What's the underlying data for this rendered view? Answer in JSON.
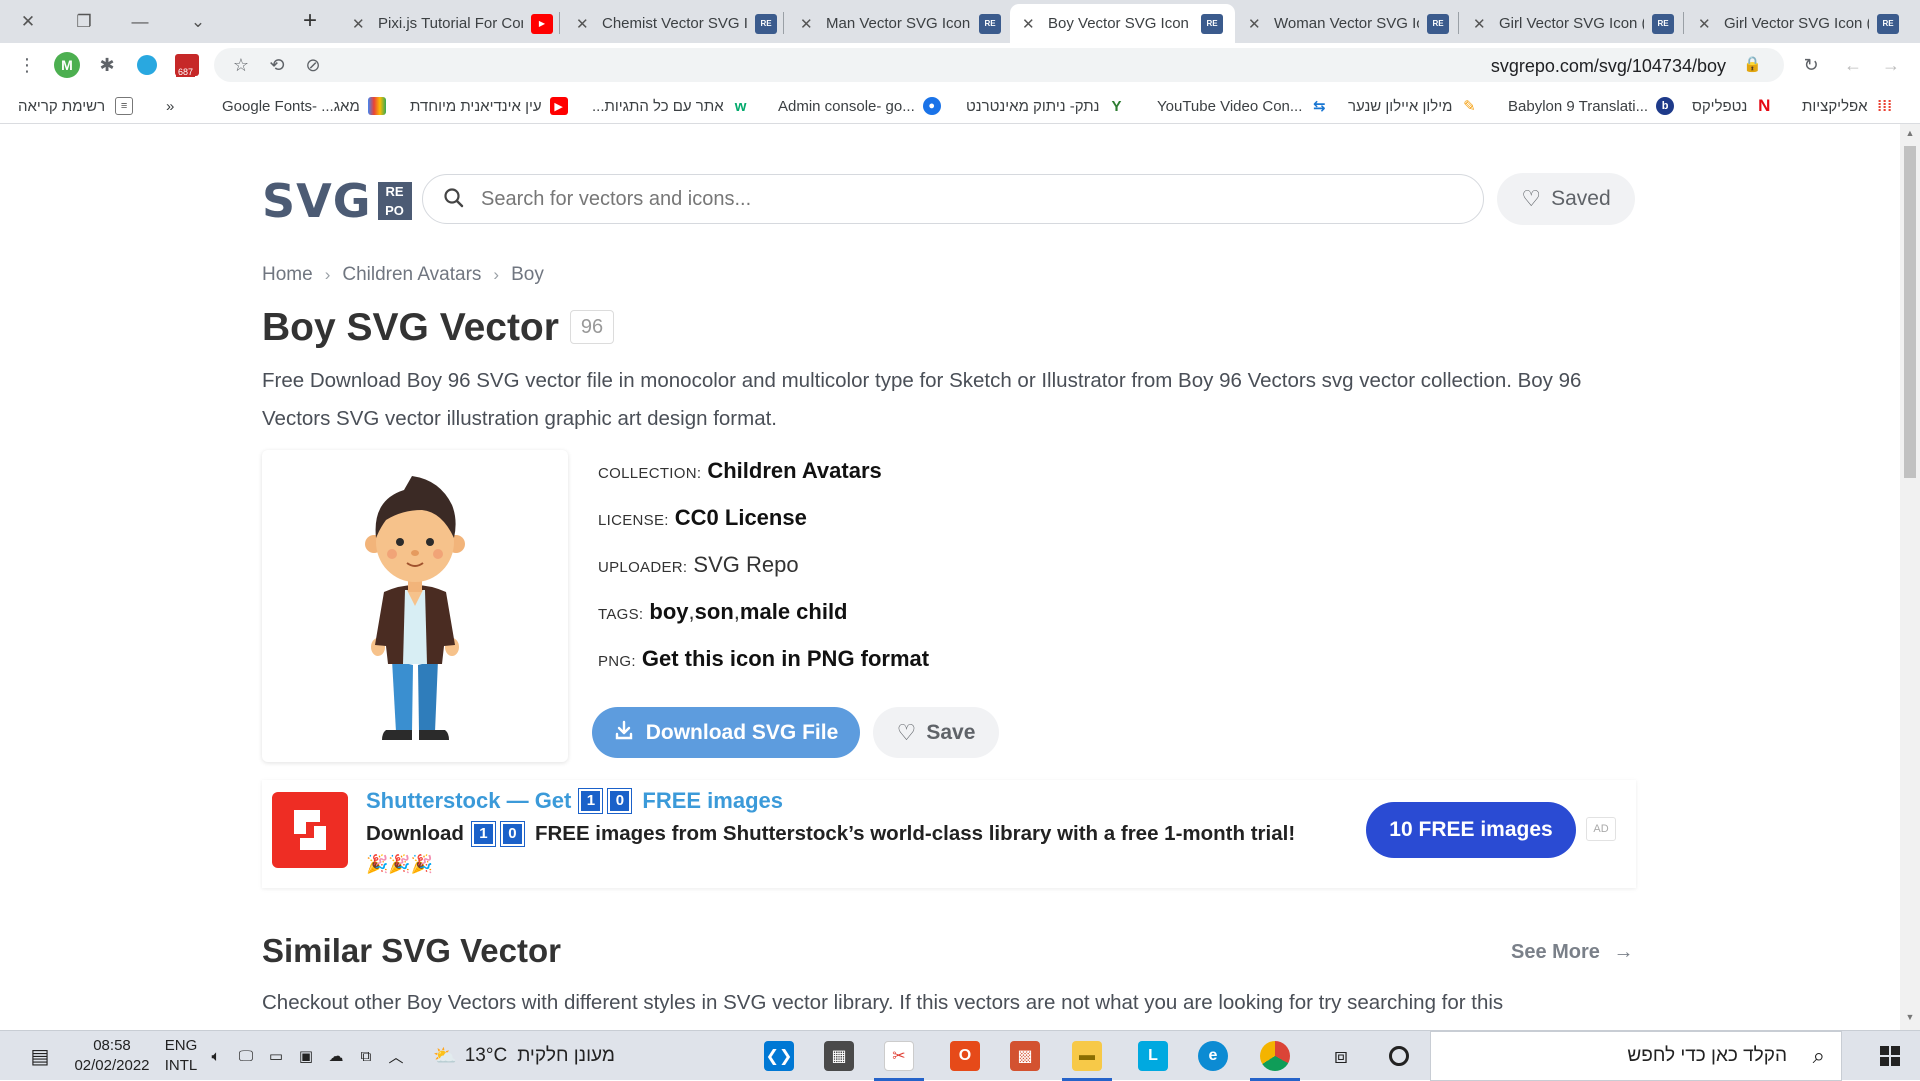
{
  "browser": {
    "window_controls": {
      "close": "✕",
      "restore": "❐",
      "minimize": "—",
      "tab_search": "⌄"
    },
    "new_tab": "+",
    "tabs": [
      {
        "title": "Pixi.js Tutorial For Con",
        "favicon": "youtube-icon",
        "active": false
      },
      {
        "title": "Chemist Vector SVG I",
        "favicon": "svgrepo-icon",
        "active": false
      },
      {
        "title": "Man Vector SVG Icon",
        "favicon": "svgrepo-icon",
        "active": false
      },
      {
        "title": "Boy Vector SVG Icon (",
        "favicon": "svgrepo-icon",
        "active": true
      },
      {
        "title": "Woman Vector SVG Ic",
        "favicon": "svgrepo-icon",
        "active": false
      },
      {
        "title": "Girl Vector SVG Icon (",
        "favicon": "svgrepo-icon",
        "active": false
      },
      {
        "title": "Girl Vector SVG Icon (",
        "favicon": "svgrepo-icon",
        "active": false
      }
    ],
    "address": {
      "url": "svgrepo.com/svg/104734/boy"
    },
    "extension_badge": "687",
    "profile_initial": "M",
    "bookmarks": [
      {
        "label": "רשימת קריאה",
        "icon": "reading-list-icon"
      },
      {
        "label": "»",
        "icon": ""
      },
      {
        "label": "Google Fonts- ...מאג",
        "icon": "google-fonts-icon"
      },
      {
        "label": "עין אינדיאנית מיוחדת",
        "icon": "youtube-icon"
      },
      {
        "label": "...אתר עם כל התגיות",
        "icon": "w3schools-icon"
      },
      {
        "label": "Admin console- go...",
        "icon": "admin-console-icon"
      },
      {
        "label": "נתק- ניתוק מאינטרנט",
        "icon": "disconnect-icon"
      },
      {
        "label": "YouTube Video Con...",
        "icon": "converter-icon"
      },
      {
        "label": "מילון איילון שנער",
        "icon": "dictionary-icon"
      },
      {
        "label": "Babylon 9 Translati...",
        "icon": "babylon-icon"
      },
      {
        "label": "נטפליקס",
        "icon": "netflix-icon"
      },
      {
        "label": "אפליקציות",
        "icon": "apps-icon"
      }
    ]
  },
  "site": {
    "logo_main": "SVG",
    "logo_sub_1": "RE",
    "logo_sub_2": "PO",
    "search_placeholder": "Search for vectors and icons...",
    "saved_label": "Saved",
    "breadcrumb": [
      "Home",
      "Children Avatars",
      "Boy"
    ],
    "title": "Boy SVG Vector",
    "title_badge": "96",
    "description": "Free Download Boy 96 SVG vector file in monocolor and multicolor type for Sketch or Illustrator from Boy 96 Vectors svg vector collection. Boy 96 Vectors SVG vector illustration graphic art design format.",
    "meta": {
      "collection_key": "Collection:",
      "collection": "Children Avatars",
      "license_key": "License:",
      "license": "CC0 License",
      "uploader_key": "Uploader:",
      "uploader": "SVG Repo",
      "tags_key": "Tags:",
      "tags": [
        "boy",
        "son",
        "male child"
      ],
      "tag_sep": ", ",
      "png_key": "PNG:",
      "png": "Get this icon in PNG format"
    },
    "download_label": "Download SVG File",
    "save_label": "Save",
    "ad": {
      "headline_prefix": "Shutterstock — Get",
      "digits": [
        "1",
        "0"
      ],
      "headline_suffix": "FREE images",
      "body_prefix": "Download",
      "body_suffix": "FREE images from Shutterstock’s world-class library with a free 1-month trial!",
      "emoji": "🎉🎉🎉",
      "cta": "10 FREE images",
      "tag": "AD"
    },
    "similar": {
      "title": "Similar SVG Vector",
      "see_more": "See More",
      "description": "Checkout other Boy Vectors with different styles in SVG vector library. If this vectors are not what you are looking for try searching for this"
    }
  },
  "taskbar": {
    "time": "08:58",
    "date": "02/02/2022",
    "lang_1": "ENG",
    "lang_2": "INTL",
    "weather_temp": "13°C",
    "weather_text": "מעונן חלקית",
    "search_placeholder": "הקלד כאן כדי לחפש",
    "apps": [
      "vscode-icon",
      "calculator-icon",
      "paint-icon",
      "office-icon",
      "powerpoint-icon",
      "file-explorer-icon",
      "l-app-icon",
      "edge-icon",
      "chrome-icon"
    ]
  },
  "colors": {
    "brand": "#4c5b74",
    "download_button": "#5d9cde",
    "ad_link": "#3b9ad9",
    "ad_cta": "#2a4bd3",
    "shutterstock": "#ee2d24"
  }
}
